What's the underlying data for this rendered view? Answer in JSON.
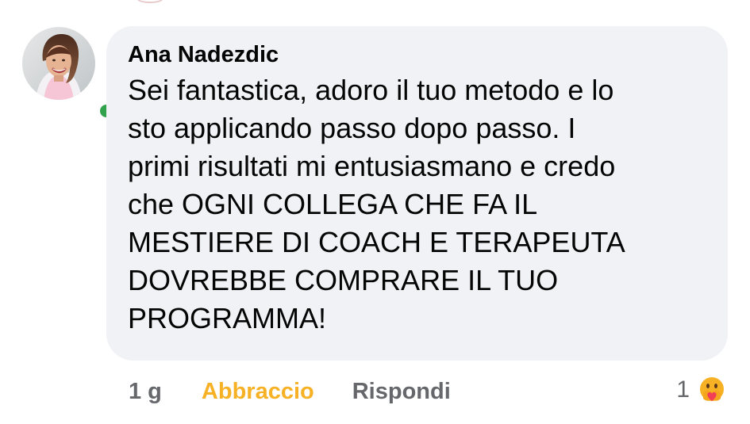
{
  "comment": {
    "author": "Ana Nadezdic",
    "text_lines": [
      "Sei fantastica, adoro il tuo metodo e lo",
      "sto applicando passo dopo passo. I",
      "primi risultati mi entusiasmano e credo",
      "che OGNI COLLEGA CHE FA IL",
      "MESTIERE DI COACH E TERAPEUTA",
      "DOVREBBE COMPRARE IL TUO",
      "PROGRAMMA!"
    ],
    "online": true
  },
  "actions": {
    "timestamp": "1 g",
    "reaction_label": "Abbraccio",
    "reply_label": "Rispondi"
  },
  "reactions": {
    "count": "1",
    "icon": "care-emoji-icon"
  },
  "colors": {
    "bubble": "#f0f2f5",
    "text": "#050505",
    "muted": "#65676b",
    "hug_reaction": "#f7b125",
    "online": "#31a24c"
  }
}
